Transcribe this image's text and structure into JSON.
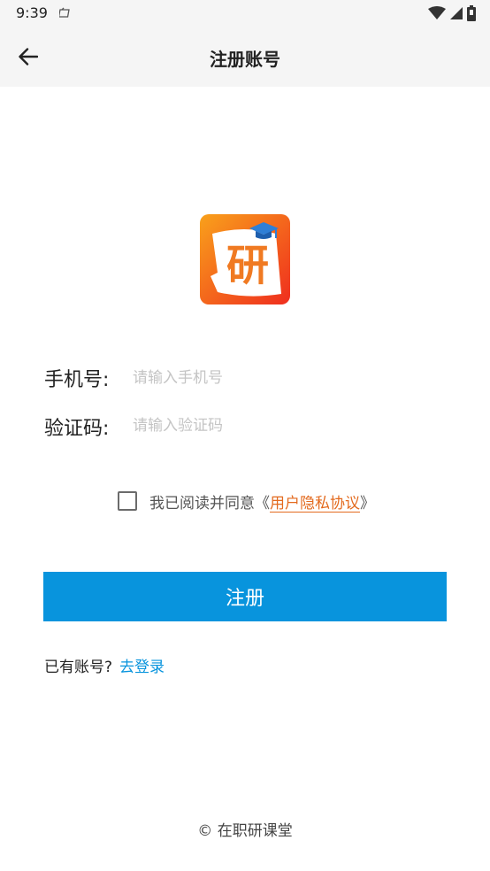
{
  "status_bar": {
    "time": "9:39"
  },
  "app_bar": {
    "title": "注册账号"
  },
  "logo": {
    "glyph": "研",
    "colors": {
      "gradient_start": "#f9a11b",
      "gradient_end": "#ef2d1e",
      "cap": "#2f7fd6"
    }
  },
  "form": {
    "phone_label": "手机号:",
    "phone_placeholder": "请输入手机号",
    "code_label": "验证码:",
    "code_placeholder": "请输入验证码"
  },
  "agreement": {
    "text": "我已阅读并同意《",
    "link": "用户隐私协议",
    "close": "》",
    "checked": false
  },
  "register_button": "注册",
  "login": {
    "prompt": "已有账号?",
    "link": "去登录"
  },
  "footer": "© 在职研课堂",
  "colors": {
    "primary": "#0894dd",
    "link_orange": "#e36a1e"
  }
}
